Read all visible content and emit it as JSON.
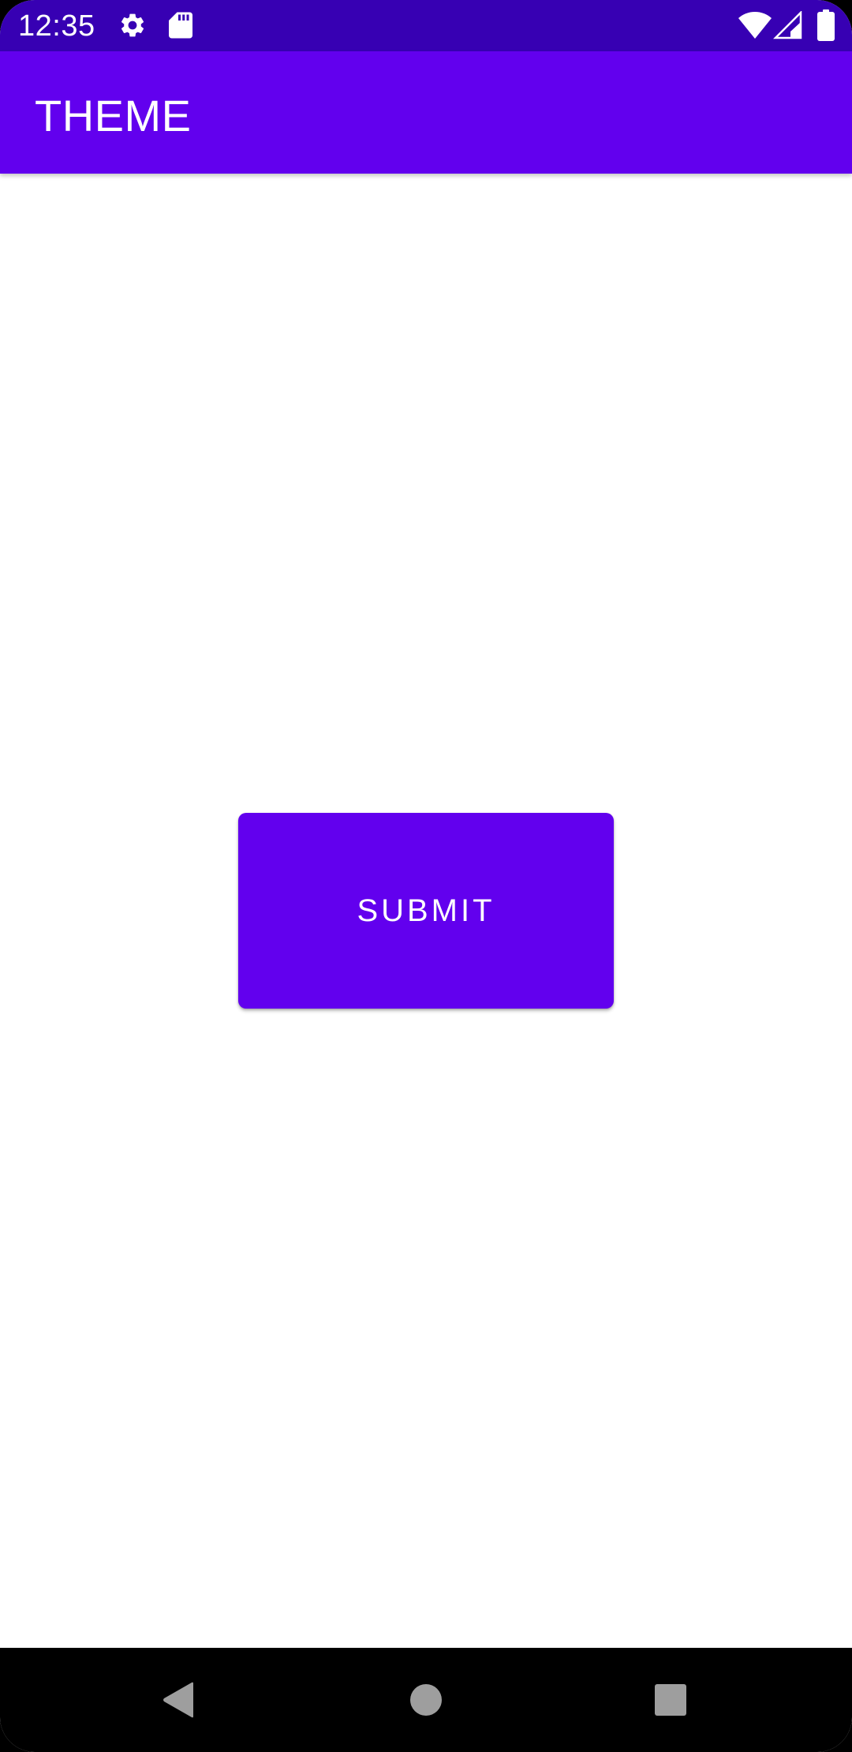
{
  "status_bar": {
    "time": "12:35",
    "background_color": "#3700b3",
    "left_icons": [
      "settings-gear-icon",
      "sd-card-icon"
    ],
    "right_icons": [
      "wifi-icon",
      "cell-signal-icon",
      "battery-icon"
    ]
  },
  "app_bar": {
    "title": "THEME",
    "background_color": "#6200ee"
  },
  "main": {
    "submit_button": {
      "label": "SUBMIT",
      "background_color": "#6200ee"
    }
  },
  "nav_bar": {
    "buttons": [
      "back-icon",
      "home-icon",
      "recents-icon"
    ]
  }
}
